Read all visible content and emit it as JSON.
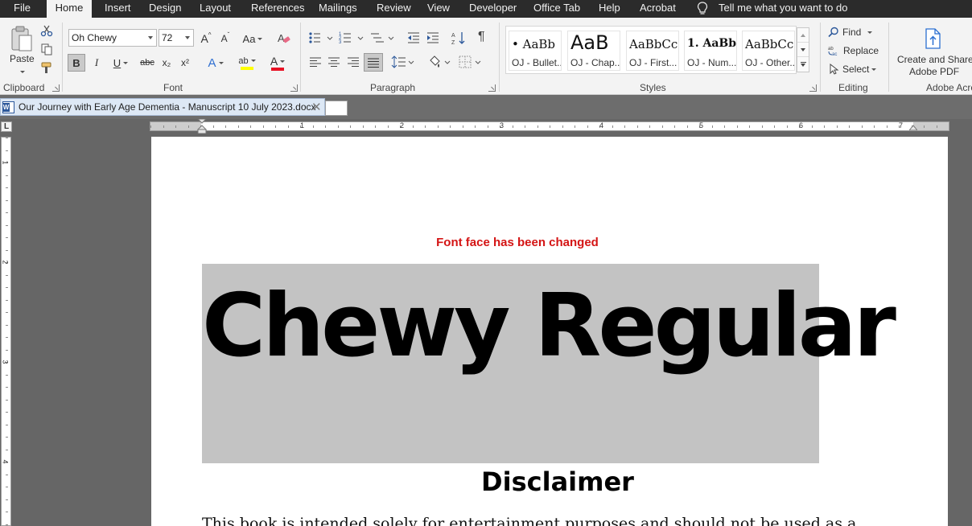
{
  "menu": {
    "tabs": [
      "File",
      "Home",
      "Insert",
      "Design",
      "Layout",
      "References",
      "Mailings",
      "Review",
      "View",
      "Developer",
      "Office Tab",
      "Help",
      "Acrobat"
    ],
    "active_tab": "Home",
    "tell_me": "Tell me what you want to do"
  },
  "ribbon": {
    "clipboard": {
      "paste_label": "Paste",
      "group_label": "Clipboard"
    },
    "font": {
      "font_name": "Oh Chewy",
      "font_size": "72",
      "change_case": "Aa",
      "bold": "B",
      "italic": "I",
      "underline": "U",
      "strikethrough": "abc",
      "subscript": "x₂",
      "superscript": "x²",
      "grow": "A",
      "shrink": "A",
      "text_effects": "A",
      "highlight": "ab",
      "font_color": "A",
      "highlight_color": "#ffff00",
      "font_color_value": "#e81123",
      "group_label": "Font"
    },
    "paragraph": {
      "pilcrow": "¶",
      "group_label": "Paragraph"
    },
    "styles": {
      "tiles": [
        {
          "sample": "• AaBb",
          "name": "OJ - Bullet..."
        },
        {
          "sample": "AaB",
          "name": "OJ - Chap..."
        },
        {
          "sample": "AaBbCc",
          "name": "OJ - First..."
        },
        {
          "sample": "1. AaBb",
          "name": "OJ - Num..."
        },
        {
          "sample": "AaBbCc",
          "name": "OJ - Other..."
        }
      ],
      "group_label": "Styles"
    },
    "editing": {
      "find": "Find",
      "replace": "Replace",
      "select": "Select",
      "group_label": "Editing"
    },
    "acrobat": {
      "create_share_line1": "Create and Share",
      "create_share_line2": "Adobe PDF",
      "group_label": "Adobe Acro"
    }
  },
  "document": {
    "tab_title": "Our Journey with Early Age Dementia - Manuscript 10 July 2023.docx",
    "ruler_numbers": [
      "1",
      "2",
      "3",
      "4",
      "5",
      "6",
      "7"
    ],
    "vruler_numbers": [
      "1",
      "2",
      "3",
      "4"
    ],
    "ruler_corner": "L",
    "notice": "Font face has been changed",
    "hero_text": "Chewy Regular",
    "heading": "Disclaimer",
    "body_line": "This book is intended solely for entertainment purposes and should not be used as a"
  }
}
